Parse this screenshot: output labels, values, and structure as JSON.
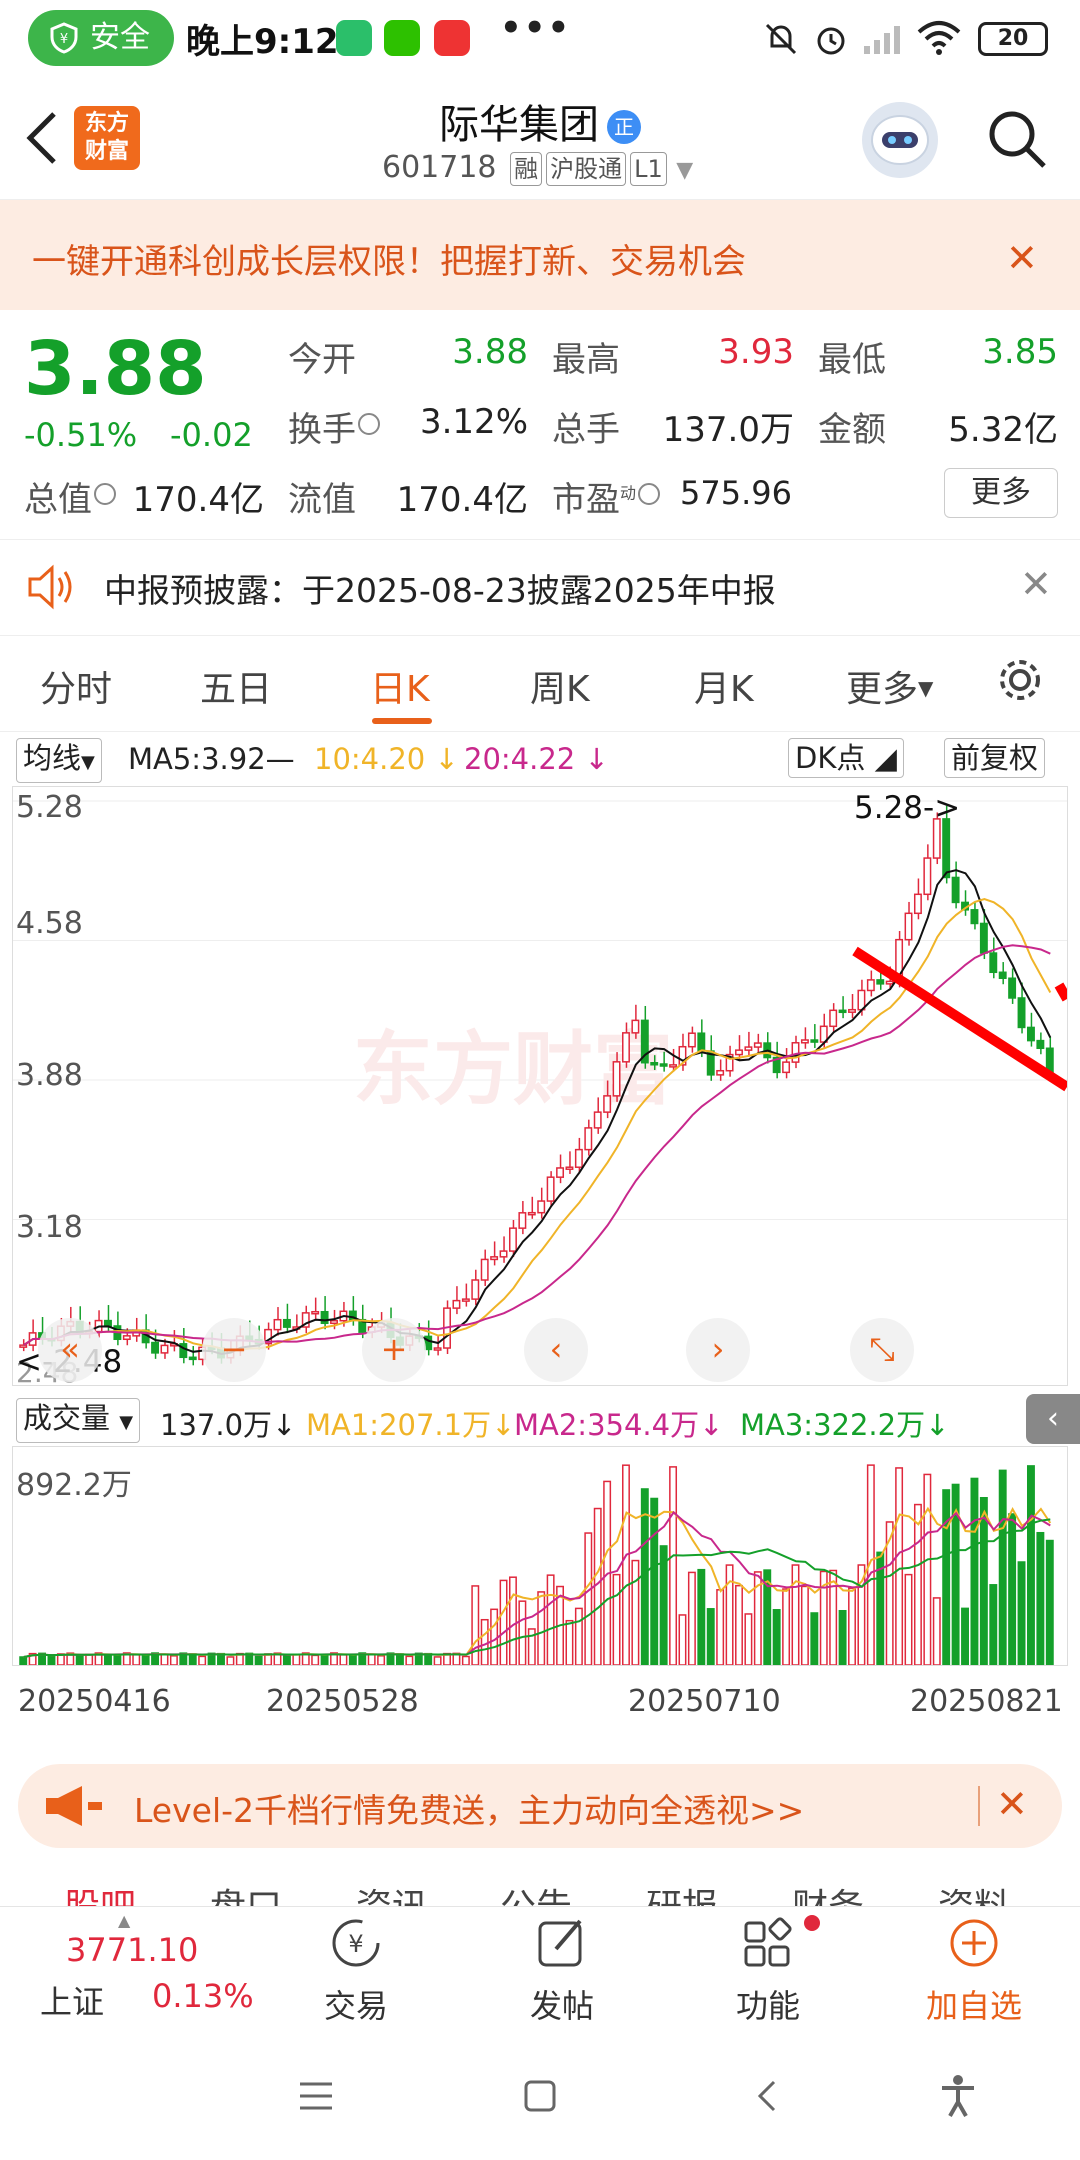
{
  "status": {
    "safe_label": "安全",
    "time": "晚上9:12",
    "dots": "•••",
    "battery": "20"
  },
  "header": {
    "title": "际华集团",
    "title_badge": "正",
    "code": "601718",
    "tags": [
      "融",
      "沪股通",
      "L1"
    ],
    "logo_line1": "东方",
    "logo_line2": "财富"
  },
  "promo": {
    "text": "一键开通科创成长层权限！把握打新、交易机会"
  },
  "quote": {
    "price": "3.88",
    "change_pct": "-0.51%",
    "change": "-0.02",
    "open_label": "今开",
    "open": "3.88",
    "high_label": "最高",
    "high": "3.93",
    "low_label": "最低",
    "low": "3.85",
    "turnover_label": "换手",
    "turnover": "3.12%",
    "volume_label": "总手",
    "volume": "137.0万",
    "amount_label": "金额",
    "amount": "5.32亿",
    "mktcap_label": "总值",
    "mktcap": "170.4亿",
    "float_label": "流值",
    "float": "170.4亿",
    "pe_label": "市盈",
    "pe_sup": "动",
    "pe": "575.96",
    "more": "更多"
  },
  "notice": {
    "text": "中报预披露：于2025-08-23披露2025年中报"
  },
  "tabs": [
    "分时",
    "五日",
    "日K",
    "周K",
    "月K",
    "更多"
  ],
  "active_tab": "日K",
  "ma": {
    "selector": "均线",
    "ma5": "MA5:3.92—",
    "ma10": "10:4.20",
    "ma20": "20:4.22",
    "dk": "DK点",
    "adjust": "前复权"
  },
  "chart": {
    "y_labels": [
      "5.28",
      "4.58",
      "3.88",
      "3.18"
    ],
    "high_marker": "5.28->",
    "low_marker": "<-2.48",
    "low_label_partial": "2.48",
    "watermark": "东方财富"
  },
  "volume": {
    "selector": "成交量",
    "vol": "137.0万",
    "ma1": "MA1:207.1万",
    "ma2": "MA2:354.4万",
    "ma3": "MA3:322.2万",
    "top_label": "892.2万"
  },
  "x_labels": [
    "20250416",
    "20250528",
    "20250710",
    "20250821"
  ],
  "level2": {
    "text": "Level-2千档行情免费送，主力动向全透视>>"
  },
  "bottom_tabs": [
    "股吧",
    "盘口",
    "资讯",
    "公告",
    "研报",
    "财务",
    "资料"
  ],
  "index": {
    "value": "3771.10",
    "name": "上证",
    "change": "0.13%"
  },
  "bottombar": [
    "交易",
    "发帖",
    "功能",
    "加自选"
  ],
  "colors": {
    "up": "#e0283c",
    "down": "#14a02a",
    "accent": "#e8601a",
    "ma5": "#111111",
    "ma10": "#f0b428",
    "ma20": "#c8288c"
  }
}
